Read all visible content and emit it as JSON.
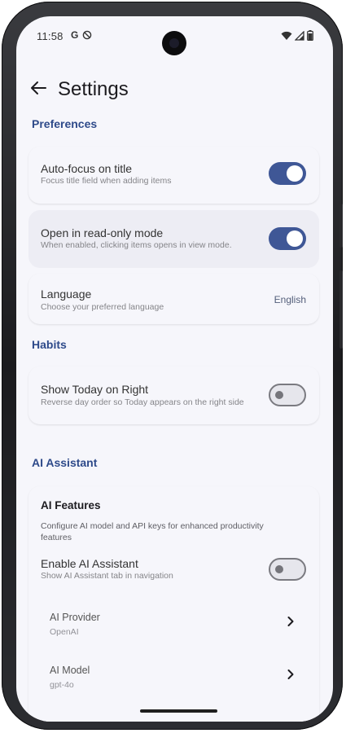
{
  "status": {
    "time": "11:58",
    "g_icon": "G",
    "dnd_icon": "dnd-icon"
  },
  "header": {
    "title": "Settings",
    "back_icon": "arrow-left-icon"
  },
  "preferences": {
    "section_title": "Preferences",
    "auto_focus": {
      "title": "Auto-focus on title",
      "subtitle": "Focus title field when adding items",
      "enabled": true
    },
    "read_only": {
      "title": "Open in read-only mode",
      "subtitle": "When enabled, clicking items opens in view mode.",
      "enabled": true
    },
    "language": {
      "title": "Language",
      "subtitle": "Choose your preferred language",
      "value": "English"
    }
  },
  "habits": {
    "section_title": "Habits",
    "show_today": {
      "title": "Show Today on Right",
      "subtitle": "Reverse day order so Today appears on the right side",
      "enabled": false
    }
  },
  "ai": {
    "section_title": "AI Assistant",
    "card_title": "AI Features",
    "card_desc_line1": "Configure AI model and API keys for enhanced productivity",
    "card_desc_line2": "features",
    "enable": {
      "title": "Enable AI Assistant",
      "subtitle": "Show AI Assistant tab in navigation",
      "enabled": false
    },
    "provider": {
      "title": "AI Provider",
      "value": "OpenAI"
    },
    "model": {
      "title": "AI Model",
      "value": "gpt-4o"
    }
  },
  "colors": {
    "accent": "#3f5796",
    "section": "#2e4a8a",
    "background": "#f6f6fb"
  }
}
